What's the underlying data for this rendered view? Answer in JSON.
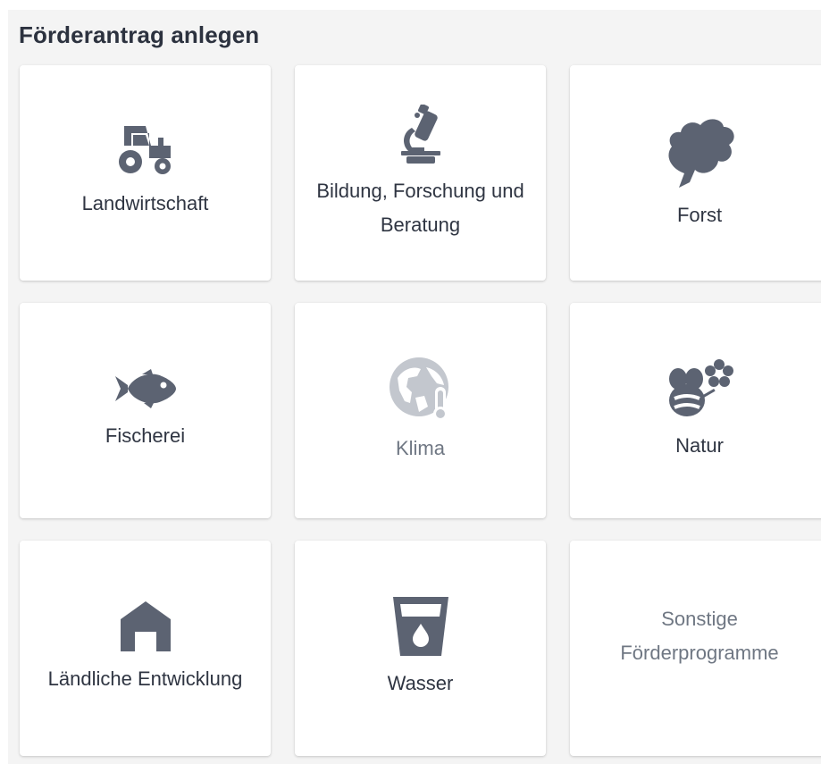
{
  "page": {
    "title": "Förderantrag anlegen"
  },
  "colors": {
    "icon": "#5c6372",
    "icon_disabled": "#c3c7ce",
    "text": "#2f3542",
    "text_muted": "#6f7783",
    "background": "#f4f4f4",
    "tile": "#ffffff"
  },
  "tiles": [
    {
      "label": "Landwirtschaft",
      "icon": "tractor-icon"
    },
    {
      "label": "Bildung, Forschung und Beratung",
      "icon": "microscope-icon"
    },
    {
      "label": "Forst",
      "icon": "leaf-icon"
    },
    {
      "label": "Fischerei",
      "icon": "fish-icon"
    },
    {
      "label": "Klima",
      "icon": "globe-thermometer-icon",
      "state": "disabled"
    },
    {
      "label": "Natur",
      "icon": "bee-flower-icon"
    },
    {
      "label": "Ländliche Entwicklung",
      "icon": "barn-icon"
    },
    {
      "label": "Wasser",
      "icon": "water-glass-icon"
    },
    {
      "label": "Sonstige Förderprogramme",
      "icon": ""
    }
  ]
}
